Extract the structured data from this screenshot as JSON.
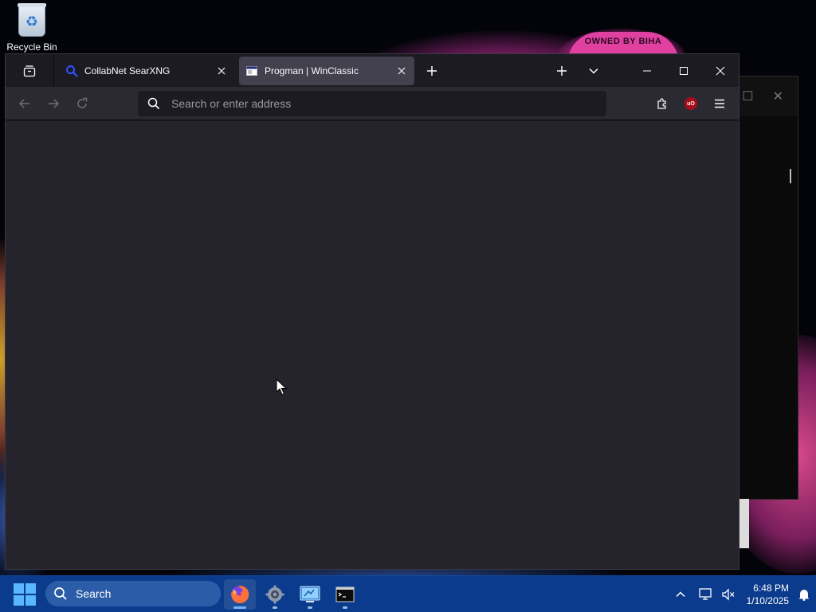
{
  "desktop": {
    "icons": [
      {
        "label": "Recycle Bin",
        "icon": "recycle-bin-icon"
      }
    ],
    "wallpaper_badge": "OWNED BY BIHA"
  },
  "browser": {
    "tabs": [
      {
        "title": "CollabNet SearXNG",
        "icon": "search-icon",
        "active": false
      },
      {
        "title": "Progman | WinClassic",
        "icon": "window-icon",
        "active": true
      }
    ],
    "urlbar": {
      "placeholder": "Search or enter address",
      "value": ""
    },
    "extensions": [
      {
        "name": "ublock-origin",
        "badge": "uO"
      }
    ]
  },
  "taskbar": {
    "search_label": "Search",
    "apps": [
      {
        "name": "firefox",
        "active": true
      },
      {
        "name": "settings",
        "active": false
      },
      {
        "name": "control-panel",
        "active": false
      },
      {
        "name": "terminal",
        "active": false
      }
    ],
    "clock": {
      "time": "6:48 PM",
      "date": "1/10/2025"
    }
  },
  "colors": {
    "taskbar": "#0b3b8c",
    "browser_toolbar": "#2b2a33",
    "browser_content": "#25242c",
    "tab_active": "#42414d",
    "accent": "#58b7ff"
  }
}
